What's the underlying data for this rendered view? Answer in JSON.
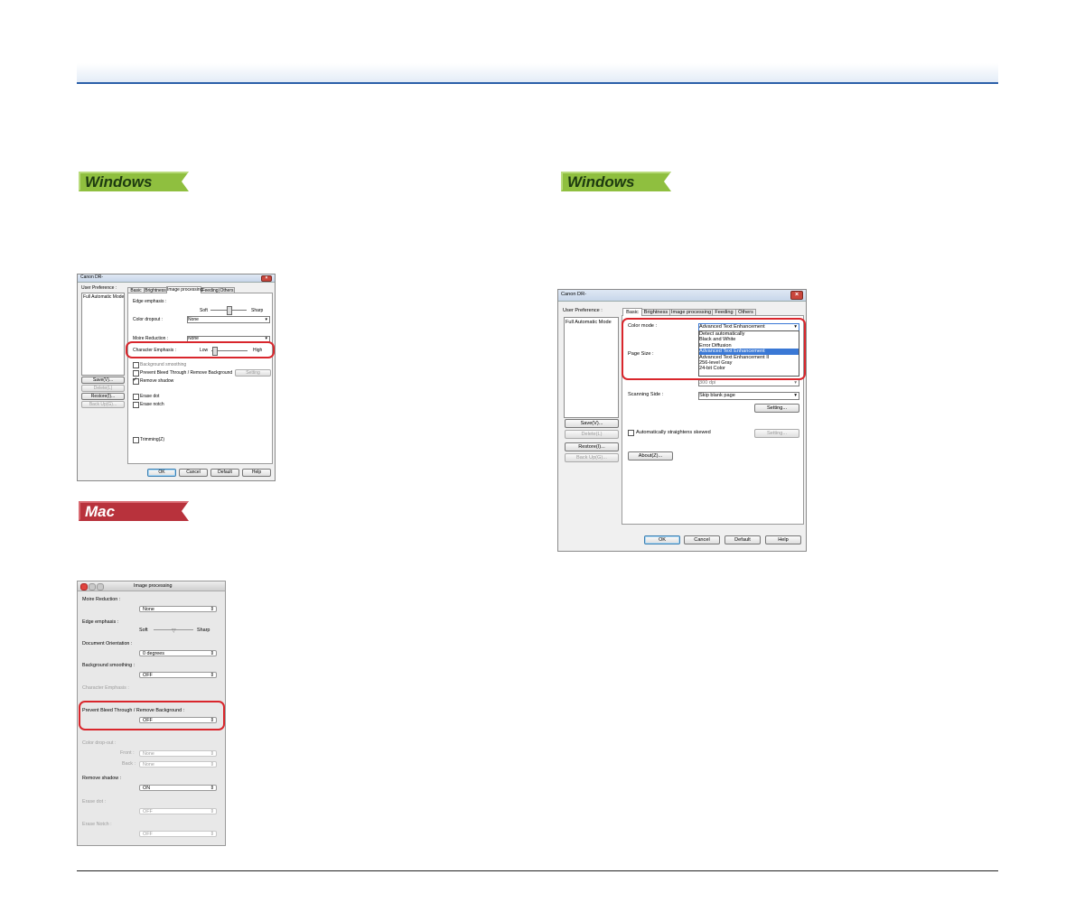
{
  "badges": {
    "windows1": "Windows",
    "windows2": "Windows",
    "mac": "Mac"
  },
  "colors": {
    "accent_blue": "#2a5fa8",
    "windows_badge": "#8fbf3f",
    "mac_badge": "#b8323c",
    "highlight_red": "#d9262c",
    "selection_blue": "#3a78d5"
  },
  "dlg1": {
    "title": "Canon DR-",
    "user_pref_label": "User Preference :",
    "list_item": "Full Automatic Mode",
    "tabs": [
      "Basic",
      "Brightness",
      "Image processing",
      "Feeding",
      "Others"
    ],
    "edge_emphasis_label": "Edge emphasis :",
    "soft": "Soft",
    "sharp": "Sharp",
    "color_dropout_label": "Color dropout :",
    "color_dropout_value": "None",
    "moire_label": "Moire Reduction :",
    "moire_value": "None",
    "char_emph_label": "Character Emphasis :",
    "low": "Low",
    "high": "High",
    "bg_smoothing": "Background smoothing",
    "prevent_bleed": "Prevent Bleed Through / Remove Background",
    "setting_btn": "Setting",
    "remove_shadow": "Remove shadow",
    "erase_dot": "Erase dot",
    "erase_notch": "Erase notch",
    "trimming": "Trimming(Z)",
    "side_buttons": [
      "Save(V)...",
      "Delete(L)",
      "Restore(I)...",
      "Back Up(G)..."
    ],
    "bottom_buttons": [
      "OK",
      "Cancel",
      "Default",
      "Help"
    ]
  },
  "dlg2": {
    "title": "Canon DR-",
    "user_pref_label": "User Preference :",
    "list_item": "Full Automatic Mode",
    "tabs": [
      "Basic",
      "Brightness",
      "Image processing",
      "Feeding",
      "Others"
    ],
    "color_mode_label": "Color mode :",
    "color_mode_value": "Advanced Text Enhancement",
    "color_mode_options": [
      "Detect automatically",
      "Black and White",
      "Error Diffusion",
      "Advanced Text Enhancement",
      "Advanced Text Enhancement II",
      "256-level Gray",
      "24-bit Color"
    ],
    "page_size_label": "Page Size :",
    "dots_value": "300 dpi",
    "scanning_side_label": "Scanning Side :",
    "scanning_side_value": "Skip blank page",
    "setting_btn": "Setting...",
    "auto_straighten": "Automatically straightens skewed",
    "setting_btn2": "Setting...",
    "about_btn": "About(Z)...",
    "side_buttons": [
      "Save(V)...",
      "Delete(L)",
      "Restore(I)...",
      "Back Up(G)..."
    ],
    "bottom_buttons": [
      "OK",
      "Cancel",
      "Default",
      "Help"
    ]
  },
  "mac": {
    "title": "Image processing",
    "moire_label": "Moire Reduction :",
    "moire_value": "None",
    "edge_label": "Edge emphasis :",
    "soft": "Soft",
    "sharp": "Sharp",
    "doc_orient_label": "Document Orientation :",
    "doc_orient_value": "0 degrees",
    "bg_smooth_label": "Background smoothing :",
    "bg_smooth_value": "OFF",
    "char_emph_label": "Character Emphasis :",
    "prevent_label": "Prevent Bleed Through / Remove Background :",
    "prevent_value": "OFF",
    "color_dropout_label": "Color drop-out :",
    "front_label": "Front :",
    "front_value": "None",
    "back_label": "Back :",
    "back_value": "None",
    "remove_shadow_label": "Remove shadow :",
    "remove_shadow_value": "ON",
    "erase_dot_label": "Erase dot :",
    "erase_dot_value": "OFF",
    "erase_notch_label": "Erase Notch :",
    "erase_notch_value": "OFF"
  }
}
